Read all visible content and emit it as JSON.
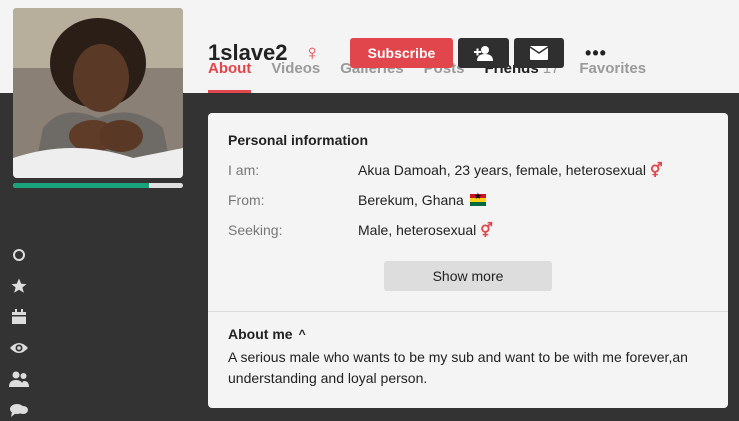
{
  "profile": {
    "username": "1slave2",
    "gender_symbol": "♀",
    "avatar_alt": "profile-photo",
    "completion_fraction": 0.8
  },
  "actions": {
    "subscribe_label": "Subscribe",
    "add_friend_icon": "add-friend-icon",
    "message_icon": "envelope-icon",
    "more_label": "•••"
  },
  "tabs": [
    {
      "label": "About",
      "active": true
    },
    {
      "label": "Videos"
    },
    {
      "label": "Galleries"
    },
    {
      "label": "Posts"
    },
    {
      "label": "Friends",
      "count": "17"
    },
    {
      "label": "Favorites"
    }
  ],
  "sidebar_icons": [
    "circle-icon",
    "star-icon",
    "calendar-icon",
    "eye-icon",
    "users-icon",
    "chat-icon"
  ],
  "personal": {
    "title": "Personal information",
    "rows": [
      {
        "label": "I am:",
        "value": "Akua Damoah, 23 years, female, heterosexual",
        "symbol": "⚥"
      },
      {
        "label": "From:",
        "value": "Berekum, Ghana",
        "flag": "ghana-flag"
      },
      {
        "label": "Seeking:",
        "value": "Male, heterosexual",
        "symbol": "⚥"
      }
    ],
    "show_more_label": "Show more"
  },
  "about": {
    "title": "About me",
    "chevron": "^",
    "text": "A serious male who wants to be my sub and want to be with me forever,an understanding and loyal person."
  },
  "colors": {
    "accent": "#e0464b",
    "dark_band": "#333333",
    "progress": "#1aa37a"
  }
}
